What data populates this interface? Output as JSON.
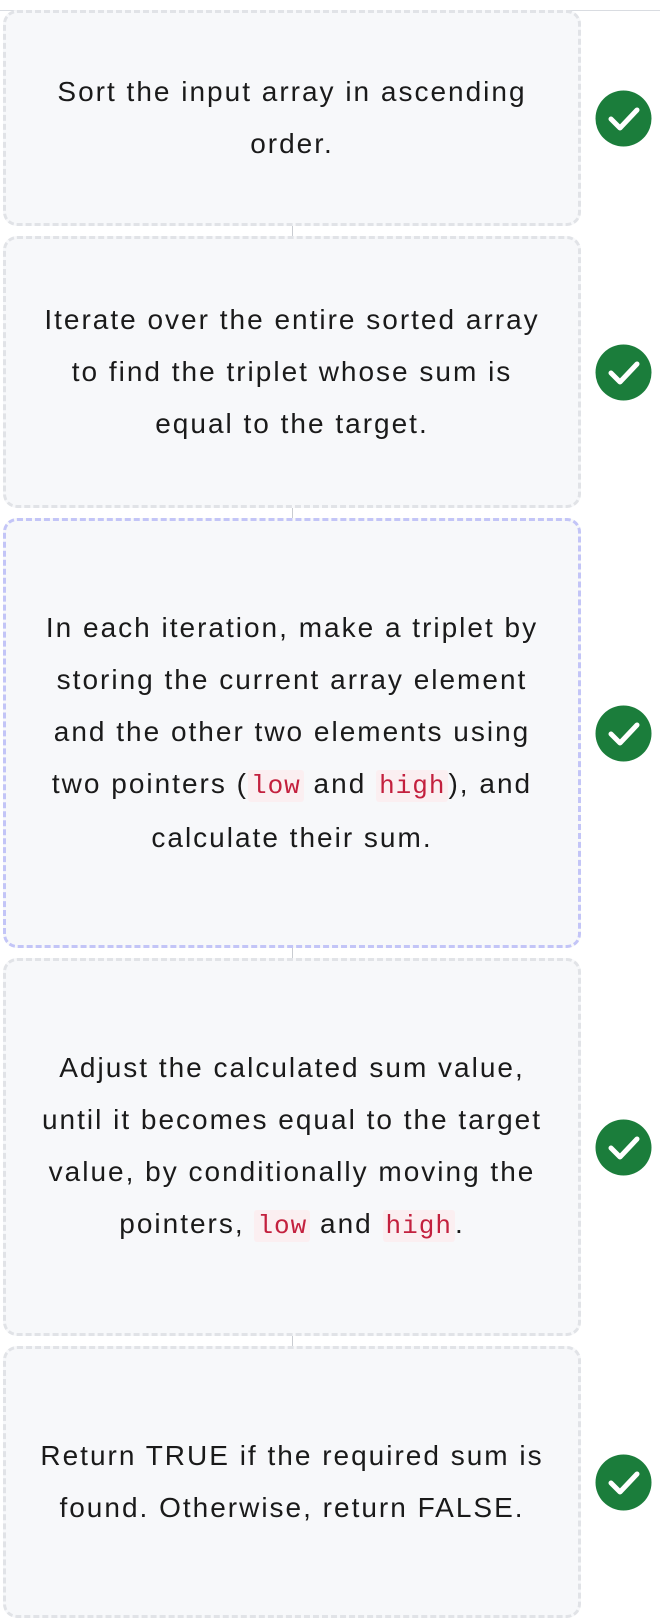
{
  "steps": [
    {
      "id": "sort",
      "status": "complete",
      "active": false,
      "segments": [
        {
          "text": "Sort the input array in ascending order.",
          "code": false
        }
      ]
    },
    {
      "id": "iterate",
      "status": "complete",
      "active": false,
      "segments": [
        {
          "text": "Iterate over the entire sorted array to find the triplet whose sum is equal to the target.",
          "code": false
        }
      ]
    },
    {
      "id": "triplet",
      "status": "complete",
      "active": true,
      "segments": [
        {
          "text": "In each iteration, make a triplet by storing the current array element and the other two elements using two pointers (",
          "code": false
        },
        {
          "text": "low",
          "code": true
        },
        {
          "text": " and ",
          "code": false
        },
        {
          "text": "high",
          "code": true
        },
        {
          "text": "), and calculate their sum.",
          "code": false
        }
      ]
    },
    {
      "id": "adjust",
      "status": "complete",
      "active": false,
      "segments": [
        {
          "text": "Adjust the calculated sum value, until it becomes equal to the target value, by conditionally moving the pointers, ",
          "code": false
        },
        {
          "text": "low",
          "code": true
        },
        {
          "text": " and ",
          "code": false
        },
        {
          "text": "high",
          "code": true
        },
        {
          "text": ".",
          "code": false
        }
      ]
    },
    {
      "id": "return",
      "status": "complete",
      "active": false,
      "segments": [
        {
          "text": "Return TRUE if the required sum is found. Otherwise, return FALSE.",
          "code": false
        }
      ]
    }
  ],
  "icons": {
    "complete": "check-circle-icon"
  },
  "colors": {
    "check_fill": "#1b7d3b",
    "check_mark": "#ffffff",
    "code_text": "#c3203e",
    "code_bg": "#fbeff1",
    "active_border": "#c3c5f7",
    "card_bg": "#f7f8fa"
  }
}
